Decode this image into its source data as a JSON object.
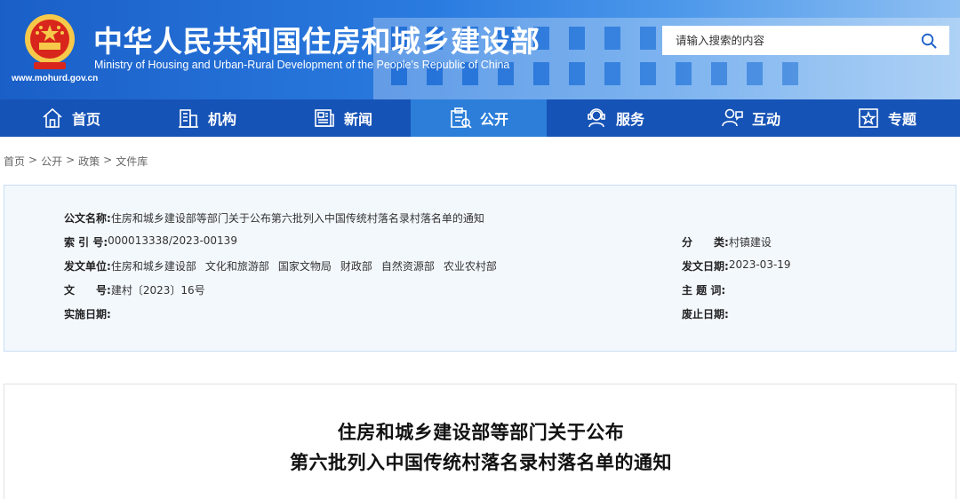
{
  "header": {
    "title": "中华人民共和国住房和城乡建设部",
    "subtitle": "Ministry of Housing and Urban-Rural Development of the People’s Republic of China",
    "url": "www.mohurd.gov.cn",
    "emblem_icon": "national-emblem-icon",
    "search": {
      "placeholder": "请输入搜索的内容",
      "icon": "search-icon"
    }
  },
  "nav": {
    "items": [
      {
        "label": "首页",
        "icon": "home-icon"
      },
      {
        "label": "机构",
        "icon": "building-icon"
      },
      {
        "label": "新闻",
        "icon": "news-icon"
      },
      {
        "label": "公开",
        "icon": "disclosure-icon",
        "active": true
      },
      {
        "label": "服务",
        "icon": "service-icon"
      },
      {
        "label": "互动",
        "icon": "interaction-icon"
      },
      {
        "label": "专题",
        "icon": "star-icon"
      }
    ]
  },
  "breadcrumb": {
    "items": [
      "首页",
      "公开",
      "政策",
      "文件库"
    ],
    "separator": ">"
  },
  "info": {
    "doc_name_label": "公文名称:",
    "doc_name": "住房和城乡建设部等部门关于公布第六批列入中国传统村落名录村落名单的通知",
    "index_label": "索 引 号:",
    "index": "000013338/2023-00139",
    "category_label": "分　　类:",
    "category": "村镇建设",
    "issuer_label": "发文单位:",
    "issuers": [
      "住房和城乡建设部",
      "文化和旅游部",
      "国家文物局",
      "财政部",
      "自然资源部",
      "农业农村部"
    ],
    "issue_date_label": "发文日期:",
    "issue_date": "2023-03-19",
    "doc_no_label": "文　　号:",
    "doc_no": "建村〔2023〕16号",
    "keywords_label": "主 题 词:",
    "keywords": "",
    "effective_date_label": "实施日期:",
    "effective_date": "",
    "repeal_date_label": "废止日期:",
    "repeal_date": ""
  },
  "document": {
    "title_line1": "住房和城乡建设部等部门关于公布",
    "title_line2": "第六批列入中国传统村落名录村落名单的通知"
  },
  "colors": {
    "header_blue": "#1a5fc8",
    "nav_blue": "#1653b6",
    "nav_active": "#2c7ed9",
    "info_bg": "#f3f8fd",
    "info_border": "#c9def3"
  }
}
